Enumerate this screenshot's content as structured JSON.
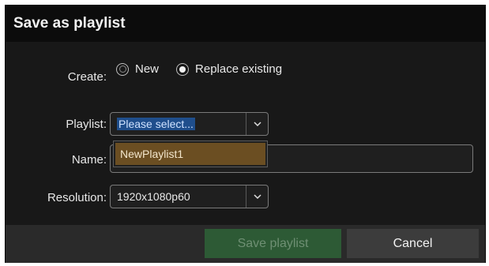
{
  "dialog": {
    "title": "Save as playlist"
  },
  "create": {
    "label": "Create:",
    "options": [
      {
        "label": "New",
        "selected": false
      },
      {
        "label": "Replace existing",
        "selected": true
      }
    ]
  },
  "playlist": {
    "label": "Playlist:",
    "placeholder": "Please select...",
    "dropdown_options": [
      "NewPlaylist1"
    ]
  },
  "name": {
    "label": "Name:",
    "value": ""
  },
  "resolution": {
    "label": "Resolution:",
    "value": "1920x1080p60"
  },
  "buttons": {
    "save": "Save playlist",
    "cancel": "Cancel"
  },
  "icons": {
    "chevron": "chevron-down-icon"
  },
  "colors": {
    "dialog_bg": "#181818",
    "titlebar_bg": "#0c0c0c",
    "highlight": "#6b4e22",
    "save_button": "#2d5a35"
  }
}
